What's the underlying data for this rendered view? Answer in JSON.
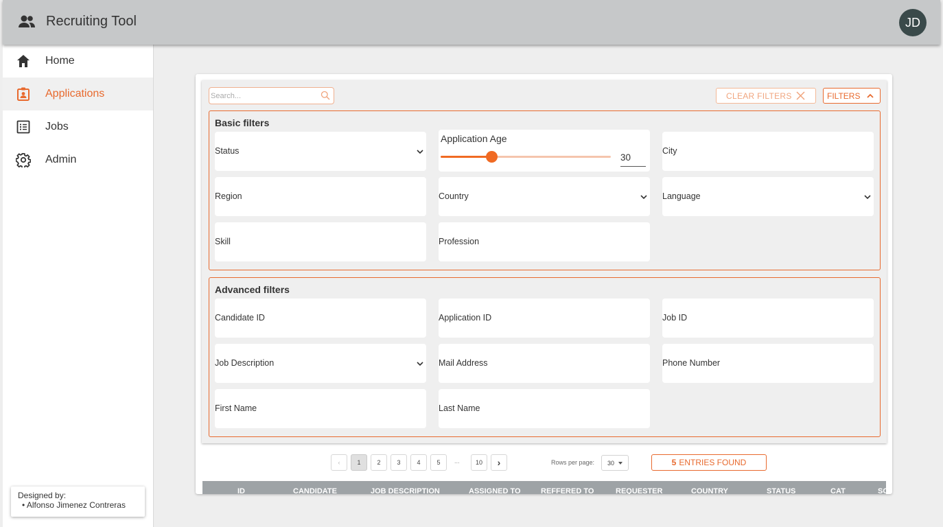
{
  "app": {
    "title": "Recruiting Tool",
    "avatar_initials": "JD",
    "logo_icon": "group-people-icon"
  },
  "colors": {
    "accent": "#e8692d",
    "appbar": "#c6c8c9",
    "avatar": "#3a4a4a",
    "table_header": "#9ea3a6"
  },
  "sidebar": {
    "items": [
      {
        "label": "Home",
        "icon": "home-icon",
        "active": false
      },
      {
        "label": "Applications",
        "icon": "applications-badge-icon",
        "active": true
      },
      {
        "label": "Jobs",
        "icon": "list-icon",
        "active": false
      },
      {
        "label": "Admin",
        "icon": "gear-icon",
        "active": false
      }
    ],
    "designer": {
      "heading": "Designed by:",
      "name": "Alfonso Jimenez Contreras"
    }
  },
  "toolbar": {
    "search_placeholder": "Search...",
    "clear_filters_label": "CLEAR FILTERS",
    "filters_label": "FILTERS"
  },
  "basic_filters": {
    "title": "Basic filters",
    "status": "Status",
    "application_age": {
      "label": "Application Age",
      "value": "30",
      "fraction": 0.3
    },
    "city": "City",
    "region": "Region",
    "country": "Country",
    "language": "Language",
    "skill": "Skill",
    "profession": "Profession"
  },
  "advanced_filters": {
    "title": "Advanced filters",
    "candidate_id": "Candidate ID",
    "application_id": "Application ID",
    "job_id": "Job ID",
    "job_description": "Job Description",
    "mail_address": "Mail Address",
    "phone_number": "Phone Number",
    "first_name": "First Name",
    "last_name": "Last Name"
  },
  "pagination": {
    "prev": "‹",
    "pages": [
      "1",
      "2",
      "3",
      "4",
      "5"
    ],
    "ellipsis": "...",
    "last_page": "10",
    "next": "›",
    "current": "1",
    "rows_per_page_label": "Rows per page:",
    "rows_per_page_value": "30",
    "entries_count": "5",
    "entries_label": "ENTRIES FOUND"
  },
  "table": {
    "columns": [
      "ID",
      "CANDIDATE",
      "JOB DESCRIPTION",
      "ASSIGNED TO",
      "REFFERED TO",
      "REQUESTER",
      "COUNTRY",
      "STATUS",
      "CAT",
      "SC"
    ]
  }
}
